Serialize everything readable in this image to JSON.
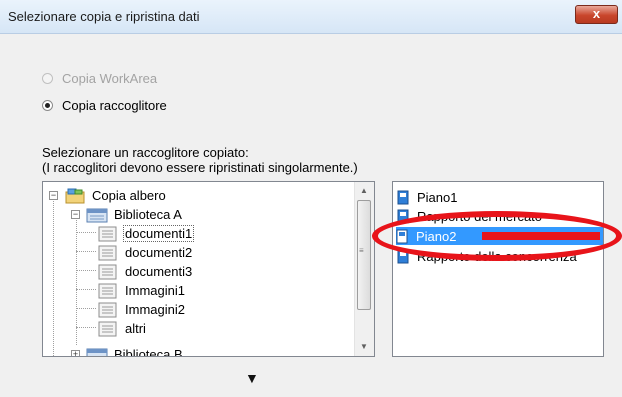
{
  "window": {
    "title": "Selezionare copia e ripristina dati",
    "close_label": "x"
  },
  "options": {
    "copy_workarea": {
      "label": "Copia WorkArea",
      "enabled": false,
      "checked": false
    },
    "copy_binder": {
      "label": "Copia raccoglitore",
      "enabled": true,
      "checked": true
    }
  },
  "instructions": {
    "line1": "Selezionare un raccoglitore copiato:",
    "line2": "(I raccoglitori devono essere ripristinati singolarmente.)"
  },
  "tree": {
    "root": {
      "label": "Copia albero",
      "icon": "copy-tree-icon",
      "expanded": true
    },
    "library_a": {
      "label": "Biblioteca A",
      "icon": "library-icon",
      "expanded": true
    },
    "children": [
      {
        "label": "documenti1",
        "icon": "binder-icon",
        "selected": true
      },
      {
        "label": "documenti2",
        "icon": "binder-icon"
      },
      {
        "label": "documenti3",
        "icon": "binder-icon"
      },
      {
        "label": "Immagini1",
        "icon": "binder-icon"
      },
      {
        "label": "Immagini2",
        "icon": "binder-icon"
      },
      {
        "label": "altri",
        "icon": "binder-icon"
      }
    ],
    "library_b": {
      "label": "Biblioteca B",
      "icon": "library-icon"
    }
  },
  "documents": [
    {
      "label": "Piano1",
      "icon": "document-book-icon",
      "selected": false
    },
    {
      "label": "Rapporto del mercato",
      "icon": "document-book-icon",
      "selected": false
    },
    {
      "label": "Piano2",
      "icon": "document-book-icon",
      "selected": true
    },
    {
      "label": "Rapporto della concorrenza",
      "icon": "document-book-icon",
      "selected": false
    }
  ],
  "annotation": {
    "color": "#e8141a"
  },
  "colors": {
    "selection": "#3399ff",
    "title_bg": "#d6e6f6",
    "close_btn": "#c9462c"
  }
}
